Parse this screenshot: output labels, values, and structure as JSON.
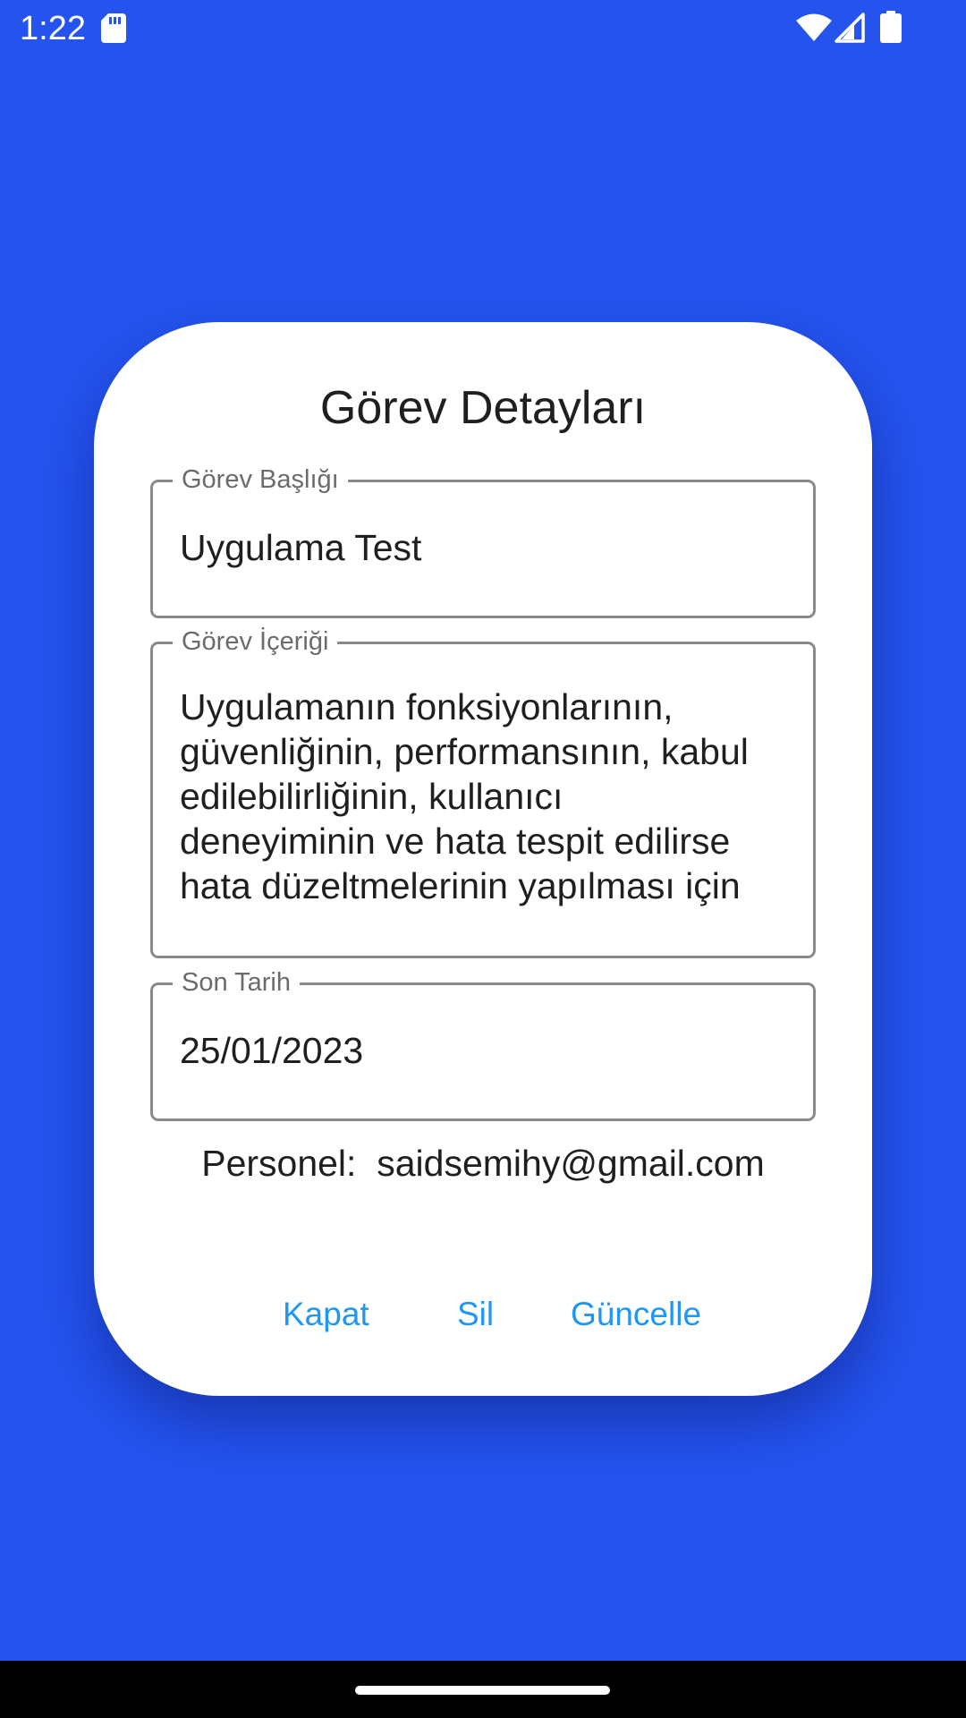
{
  "status_bar": {
    "time": "1:22",
    "icons": [
      "sd-card-icon",
      "wifi-icon",
      "signal-icon",
      "battery-icon"
    ]
  },
  "dialog": {
    "title": "Görev Detayları",
    "title_field": {
      "label": "Görev Başlığı",
      "value": "Uygulama Test"
    },
    "content_field": {
      "label": "Görev İçeriği",
      "value": "Uygulamanın fonksiyonlarının,\ngüvenliğinin, performansının, kabul\nedilebilirliğinin, kullanıcı\ndeneyiminin ve hata tespit edilirse\nhata düzeltmelerinin yapılması için"
    },
    "date_field": {
      "label": "Son Tarih",
      "value": "25/01/2023"
    },
    "personnel": {
      "label": "Personel:",
      "value": "saidsemihy@gmail.com"
    },
    "buttons": {
      "close": "Kapat",
      "delete": "Sil",
      "update": "Güncelle"
    }
  },
  "colors": {
    "background": "#2453EE",
    "accent": "#2196F3",
    "dialog": "#FFFFFF",
    "nav_bar": "#000000"
  }
}
